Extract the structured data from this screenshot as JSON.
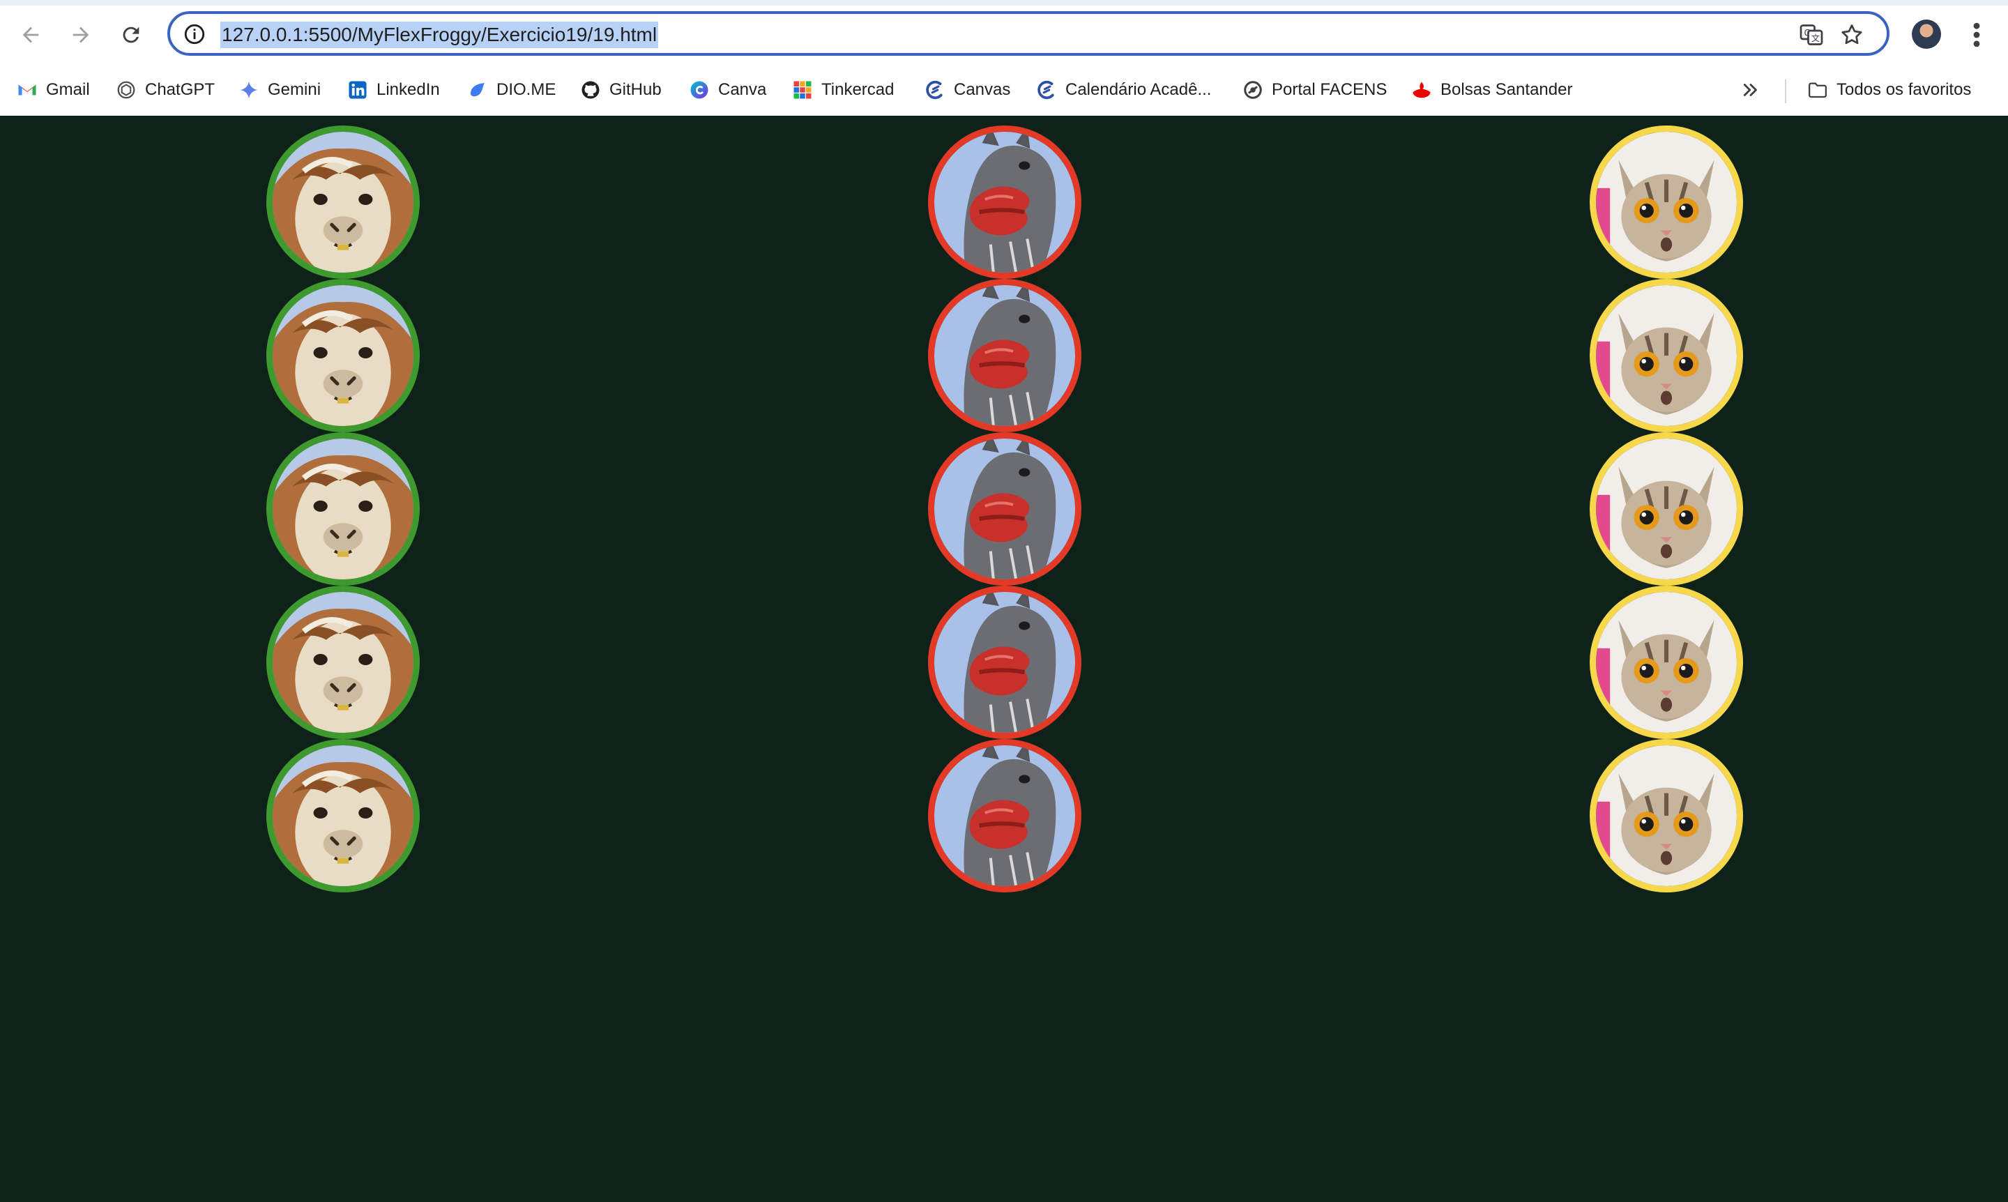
{
  "browser": {
    "url": "127.0.0.1:5500/MyFlexFroggy/Exercicio19/19.html",
    "icons": [
      "back-icon",
      "forward-icon",
      "reload-icon",
      "info-icon",
      "translate-icon",
      "star-icon",
      "profile-avatar",
      "more-menu-icon"
    ]
  },
  "bookmarks": [
    {
      "label": "Gmail",
      "icon": "gmail-icon"
    },
    {
      "label": "ChatGPT",
      "icon": "chatgpt-icon"
    },
    {
      "label": "Gemini",
      "icon": "gemini-icon"
    },
    {
      "label": "LinkedIn",
      "icon": "linkedin-icon"
    },
    {
      "label": "DIO.ME",
      "icon": "dio-icon"
    },
    {
      "label": "GitHub",
      "icon": "github-icon"
    },
    {
      "label": "Canva",
      "icon": "canva-icon"
    },
    {
      "label": "Tinkercad",
      "icon": "tinkercad-icon"
    },
    {
      "label": "Canvas",
      "icon": "canvas-icon"
    },
    {
      "label": "Calendário Acadê...",
      "icon": "calendar-icon"
    },
    {
      "label": "Portal FACENS",
      "icon": "facens-icon"
    },
    {
      "label": "Bolsas Santander",
      "icon": "santander-icon"
    }
  ],
  "all_bookmarks_label": "Todos os favoritos",
  "colors": {
    "page_background": "#0e2219",
    "green_border": "#3e9a2e",
    "red_border": "#e23a26",
    "yellow_border": "#f6d84a",
    "omnibox_border": "#3b63c4"
  },
  "columns": [
    {
      "name": "green",
      "subject": "alpaca",
      "count": 5,
      "border": "#3e9a2e"
    },
    {
      "name": "red",
      "subject": "donkey-with-lips",
      "count": 5,
      "border": "#e23a26"
    },
    {
      "name": "yellow",
      "subject": "surprised-cat",
      "count": 5,
      "border": "#f6d84a"
    }
  ]
}
